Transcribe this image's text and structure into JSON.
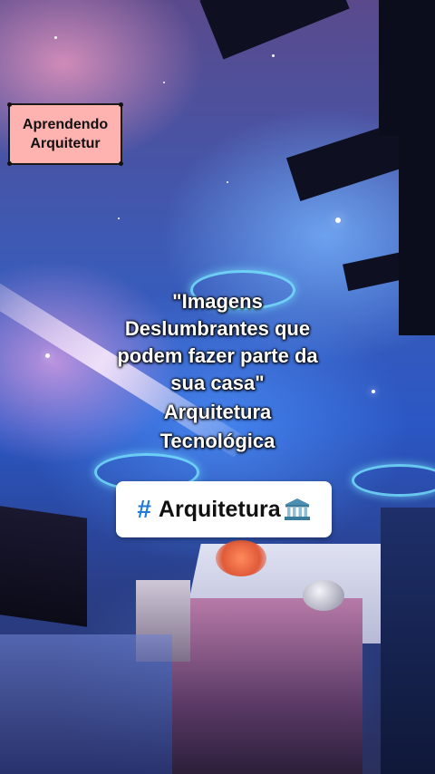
{
  "badge": {
    "line1": "Aprendendo",
    "line2": "Arquitetur"
  },
  "caption": {
    "quote_lines": [
      "\"Imagens",
      "Deslumbrantes que",
      "podem fazer parte da",
      "sua casa\""
    ],
    "subtitle_lines": [
      "Arquitetura",
      "Tecnológica"
    ]
  },
  "hashtag": {
    "symbol": "#",
    "text": "Arquitetura",
    "emoji_icon": "classical-building-icon"
  },
  "colors": {
    "badge_bg": "#ffb3b0",
    "hash_blue": "#1f7ad9",
    "tag_bg": "#ffffff"
  }
}
